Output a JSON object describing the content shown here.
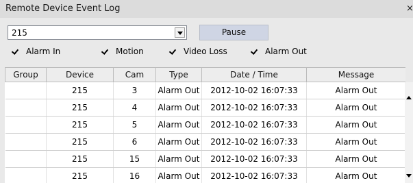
{
  "window": {
    "title": "Remote Device Event Log",
    "close_glyph": "×"
  },
  "device_select": {
    "value": "215"
  },
  "pause_button": {
    "label": "Pause"
  },
  "filters": [
    {
      "label": "Alarm In",
      "checked": true
    },
    {
      "label": "Motion",
      "checked": true
    },
    {
      "label": "Video Loss",
      "checked": true
    },
    {
      "label": "Alarm Out",
      "checked": true
    }
  ],
  "table": {
    "columns": [
      "Group",
      "Device",
      "Cam",
      "Type",
      "Date / Time",
      "Message"
    ],
    "rows": [
      {
        "group": "",
        "device": "215",
        "cam": "3",
        "type": "Alarm Out",
        "datetime": "2012-10-02 16:07:33",
        "message": "Alarm Out"
      },
      {
        "group": "",
        "device": "215",
        "cam": "4",
        "type": "Alarm Out",
        "datetime": "2012-10-02 16:07:33",
        "message": "Alarm Out"
      },
      {
        "group": "",
        "device": "215",
        "cam": "5",
        "type": "Alarm Out",
        "datetime": "2012-10-02 16:07:33",
        "message": "Alarm Out"
      },
      {
        "group": "",
        "device": "215",
        "cam": "6",
        "type": "Alarm Out",
        "datetime": "2012-10-02 16:07:33",
        "message": "Alarm Out"
      },
      {
        "group": "",
        "device": "215",
        "cam": "15",
        "type": "Alarm Out",
        "datetime": "2012-10-02 16:07:33",
        "message": "Alarm Out"
      },
      {
        "group": "",
        "device": "215",
        "cam": "16",
        "type": "Alarm Out",
        "datetime": "2012-10-02 16:07:33",
        "message": "Alarm Out"
      }
    ]
  },
  "icons": {
    "close": "close-icon",
    "dropdown": "chevron-down-icon",
    "checkbox": "checkmark-icon",
    "scroll_up": "scroll-up-arrow-icon",
    "scroll_down": "scroll-down-arrow-icon"
  }
}
